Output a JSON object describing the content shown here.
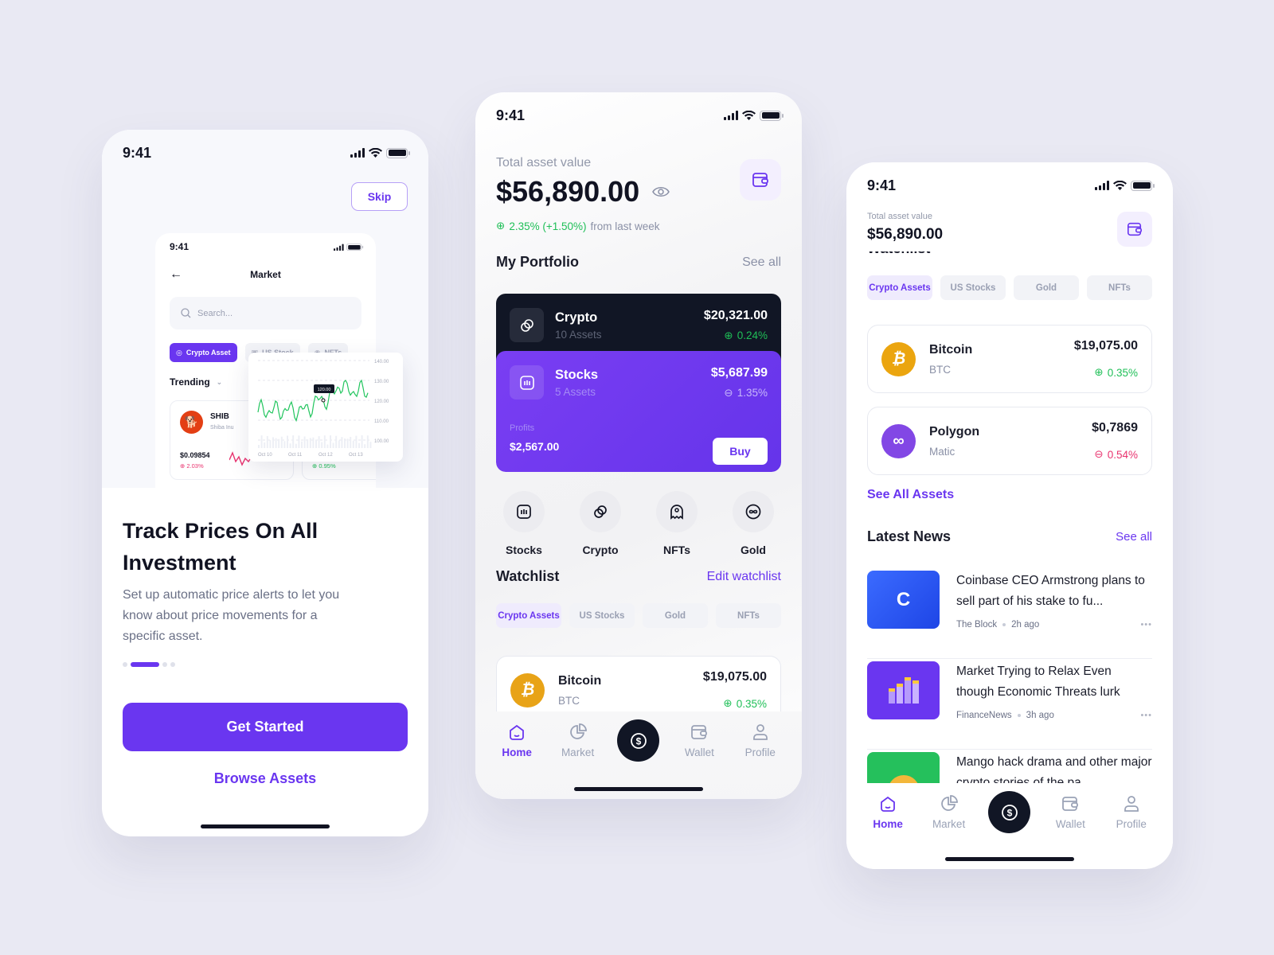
{
  "colors": {
    "accent": "#6a36f0",
    "up": "#1fbf57",
    "down": "#e9336f",
    "dark": "#111625",
    "bitcoin": "#eba50f",
    "polygon": "#8247e5"
  },
  "status_time": "9:41",
  "onboarding": {
    "skip_label": "Skip",
    "mini_market": {
      "time": "9:41",
      "title": "Market",
      "search_placeholder": "Search...",
      "chips": [
        "Crypto Asset",
        "US Stock",
        "NFTs"
      ],
      "trending_label": "Trending",
      "card1": {
        "symbol": "SHIB",
        "name": "Shiba Inu",
        "price": "$0.09854",
        "change": "2.03%"
      },
      "card2": {
        "change": "0.95%"
      },
      "chart": {
        "tooltip": "120.00",
        "yticks": [
          "140.00",
          "130.00",
          "120.00",
          "110.00",
          "100.00"
        ],
        "xticks": [
          "Oct 10",
          "Oct 11",
          "Oct 12",
          "Oct 13"
        ]
      }
    },
    "title": "Track Prices On All Investment",
    "subtitle": "Set up automatic price alerts to let you know about price movements for a specific asset.",
    "page_indicator": {
      "current": 2,
      "total": 4
    },
    "get_started_label": "Get Started",
    "browse_label": "Browse Assets"
  },
  "home": {
    "total_label": "Total asset value",
    "total_value": "$56,890.00",
    "change_text": "2.35% (+1.50%)",
    "change_suffix": "from last week",
    "portfolio_title": "My Portfolio",
    "see_all": "See all",
    "portfolio": [
      {
        "name": "Crypto",
        "count": "10 Assets",
        "value": "$20,321.00",
        "change": "0.24%",
        "direction": "up"
      },
      {
        "name": "Stocks",
        "count": "5 Assets",
        "value": "$5,687.99",
        "change": "1.35%",
        "direction": "down"
      }
    ],
    "profits_label": "Profits",
    "profits_value": "$2,567.00",
    "buy_label": "Buy",
    "categories": [
      "Stocks",
      "Crypto",
      "NFTs",
      "Gold"
    ],
    "watchlist_title": "Watchlist",
    "edit_watchlist": "Edit watchlist",
    "watch_tabs": [
      "Crypto Assets",
      "US Stocks",
      "Gold",
      "NFTs"
    ],
    "watch_items": [
      {
        "name": "Bitcoin",
        "symbol": "BTC",
        "price": "$19,075.00",
        "change": "0.35%",
        "direction": "up"
      }
    ]
  },
  "home2": {
    "total_label": "Total asset value",
    "total_value": "$56,890.00",
    "watch_tabs": [
      "Crypto Assets",
      "US Stocks",
      "Gold",
      "NFTs"
    ],
    "watch_items": [
      {
        "name": "Bitcoin",
        "symbol": "BTC",
        "price": "$19,075.00",
        "change": "0.35%",
        "direction": "up"
      },
      {
        "name": "Polygon",
        "symbol": "Matic",
        "price": "$0,7869",
        "change": "0.54%",
        "direction": "down"
      }
    ],
    "see_all_assets": "See All Assets",
    "news_title": "Latest News",
    "see_all": "See all",
    "news": [
      {
        "title": "Coinbase CEO Armstrong plans to sell part of his stake to fu...",
        "source": "The Block",
        "time": "2h ago",
        "thumb_color": "#2f5cf5"
      },
      {
        "title": "Market Trying to Relax Even though Economic Threats lurk",
        "source": "FinanceNews",
        "time": "3h ago",
        "thumb_color": "#6a36f0"
      },
      {
        "title": "Mango hack drama and other major crypto stories of the pa",
        "source": "",
        "time": "",
        "thumb_color": "#25c05c"
      }
    ]
  },
  "nav": {
    "items": [
      "Home",
      "Market",
      "",
      "Wallet",
      "Profile"
    ],
    "active": "Home"
  }
}
